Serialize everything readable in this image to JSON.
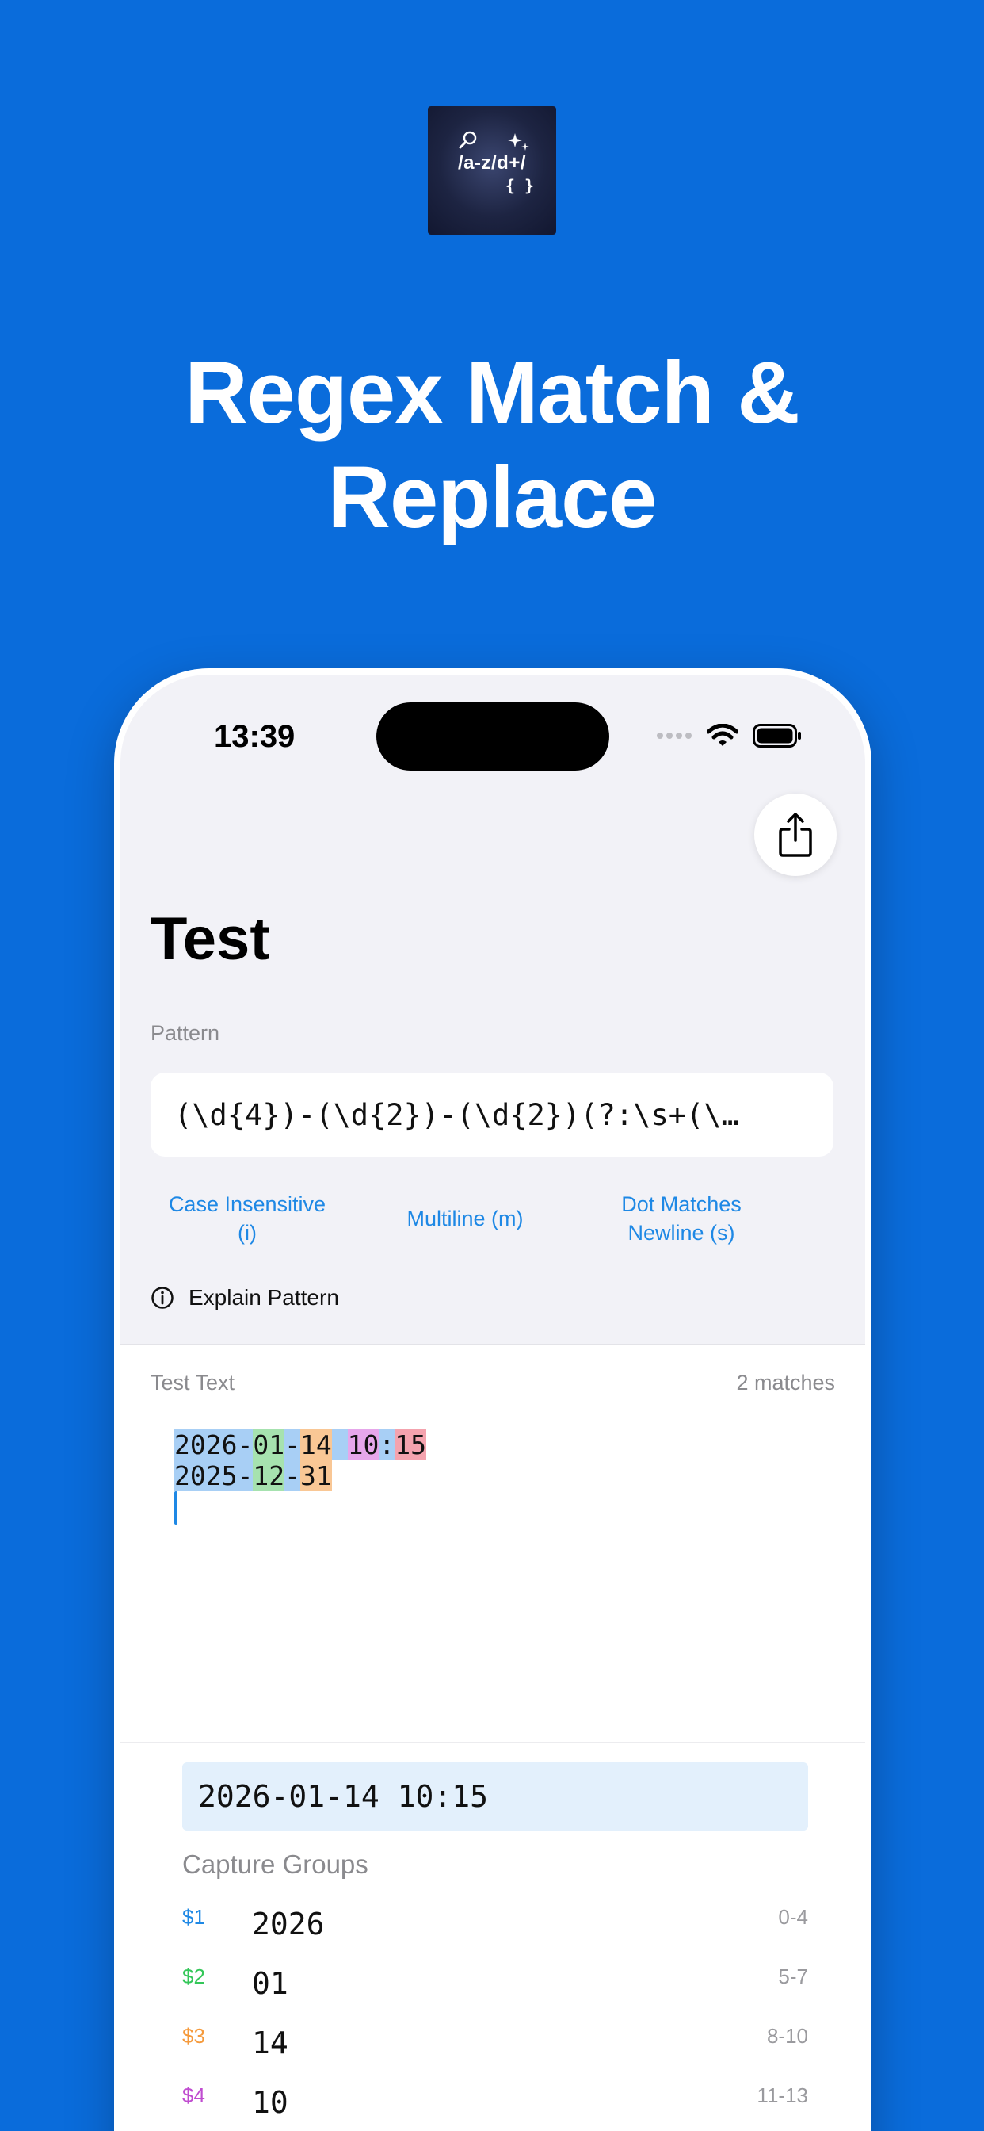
{
  "promo": {
    "icon_text": "/a-z/d+/",
    "icon_braces": "{ }",
    "headline_line1": "Regex Match &",
    "headline_line2": "Replace"
  },
  "status_bar": {
    "time": "13:39"
  },
  "screen": {
    "title": "Test",
    "pattern_label": "Pattern",
    "pattern_value": "(\\d{4})-(\\d{2})-(\\d{2})(?:\\s+(\\…",
    "options": [
      {
        "line1": "Case Insensitive",
        "line2": "(i)"
      },
      {
        "line1": "Multiline (m)",
        "line2": ""
      },
      {
        "line1": "Dot Matches",
        "line2": "Newline (s)"
      }
    ],
    "explain_label": "Explain Pattern",
    "test_text_label": "Test Text",
    "match_count": "2 matches",
    "test_lines": [
      {
        "year": "2026",
        "sep1": "-",
        "month": "01",
        "sep2": "-",
        "day": "14",
        "space": " ",
        "hour": "10",
        "colon": ":",
        "minute": "15"
      },
      {
        "year": "2025",
        "sep1": "-",
        "month": "12",
        "sep2": "-",
        "day": "31"
      }
    ],
    "selected_match": "2026-01-14 10:15",
    "capture_groups_label": "Capture Groups",
    "capture_groups": [
      {
        "num": "$1",
        "value": "2026",
        "range": "0-4",
        "color": "#1E88E5"
      },
      {
        "num": "$2",
        "value": "01",
        "range": "5-7",
        "color": "#34C759"
      },
      {
        "num": "$3",
        "value": "14",
        "range": "8-10",
        "color": "#F59A3C"
      },
      {
        "num": "$4",
        "value": "10",
        "range": "11-13",
        "color": "#C04CD0"
      }
    ]
  },
  "colors": {
    "background": "#0A6CDB",
    "accent": "#1E88E5",
    "highlight_group1": "#A8CFF5",
    "highlight_group2": "#A6E2AF",
    "highlight_group3": "#F9C795",
    "highlight_group4": "#E6A7EB",
    "highlight_group5": "#F4A3AE"
  }
}
